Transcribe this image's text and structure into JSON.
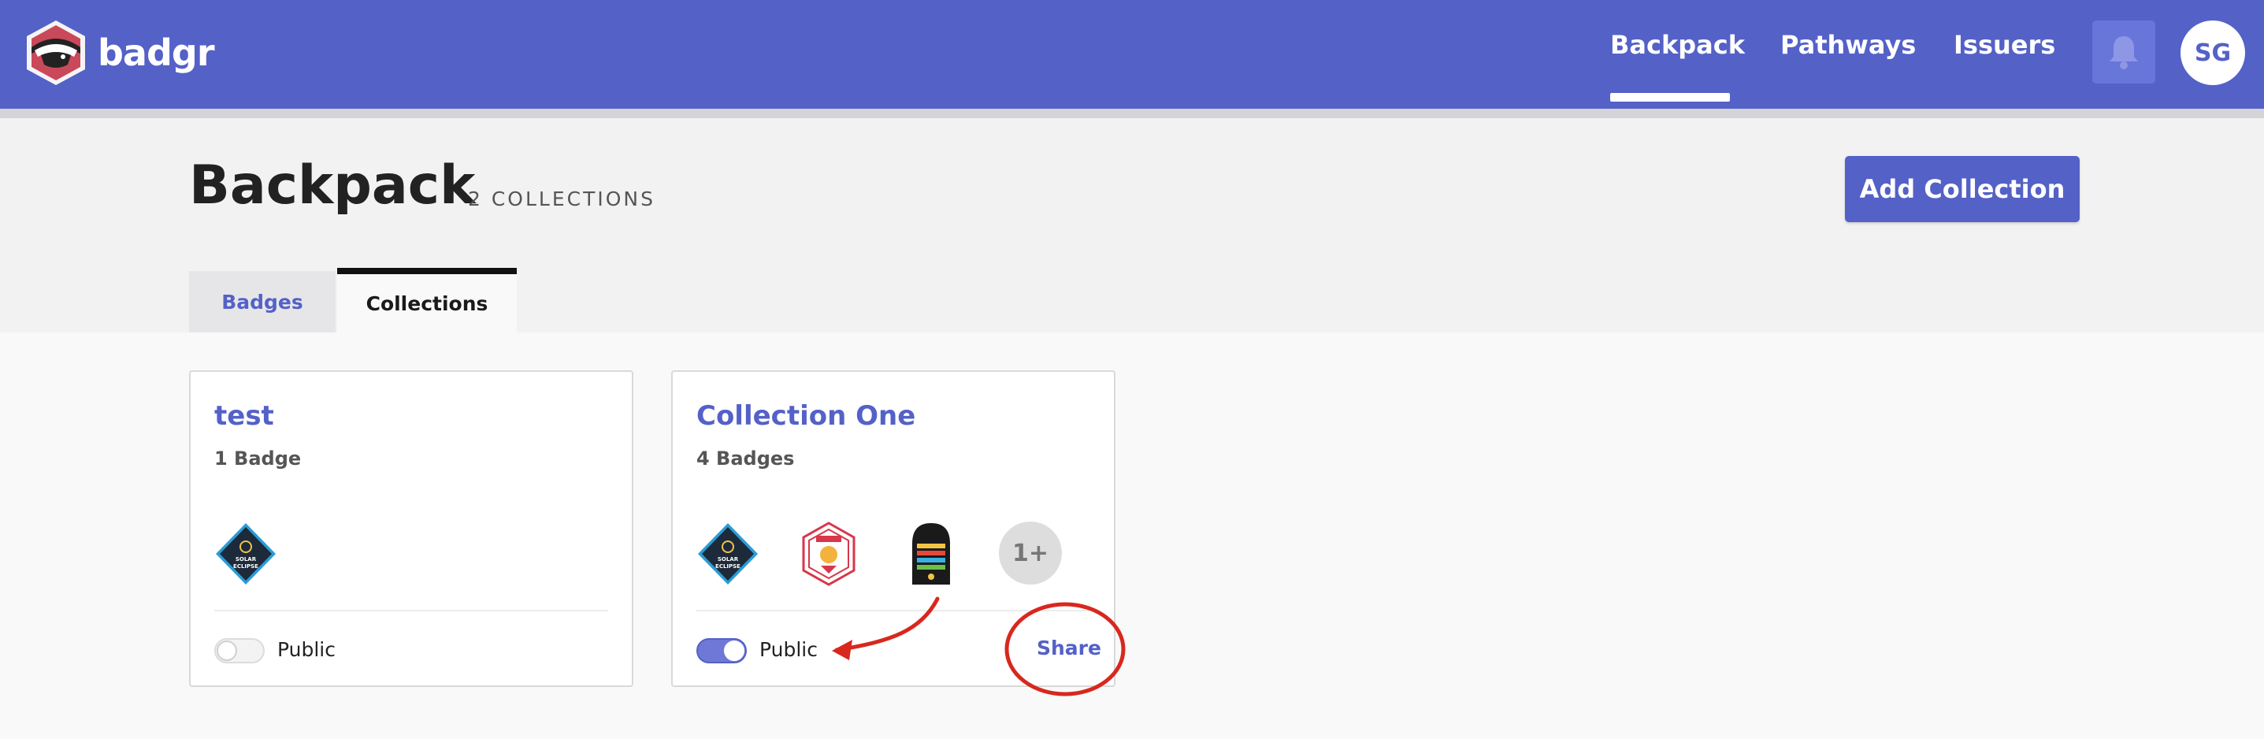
{
  "header": {
    "logo_text": "badgr",
    "nav": [
      {
        "label": "Backpack",
        "active": true
      },
      {
        "label": "Pathways",
        "active": false
      },
      {
        "label": "Issuers",
        "active": false
      }
    ],
    "bell_icon": "bell-icon",
    "avatar_initials": "SG"
  },
  "page": {
    "title": "Backpack",
    "count_label": "2 COLLECTIONS",
    "add_button_label": "Add Collection",
    "tabs": [
      {
        "label": "Badges",
        "active": false
      },
      {
        "label": "Collections",
        "active": true
      }
    ]
  },
  "collections": [
    {
      "title": "test",
      "badge_count": "1 Badge",
      "public": false,
      "public_label": "Public",
      "badges": [
        "solar-eclipse-badge"
      ]
    },
    {
      "title": "Collection One",
      "badge_count": "4 Badges",
      "public": true,
      "public_label": "Public",
      "share_label": "Share",
      "badges": [
        "solar-eclipse-badge",
        "badge-hexagon-red",
        "arched-colorful-badge"
      ],
      "more_label": "1+"
    }
  ],
  "colors": {
    "brand": "#5461c7",
    "annotation": "#d8281e"
  }
}
